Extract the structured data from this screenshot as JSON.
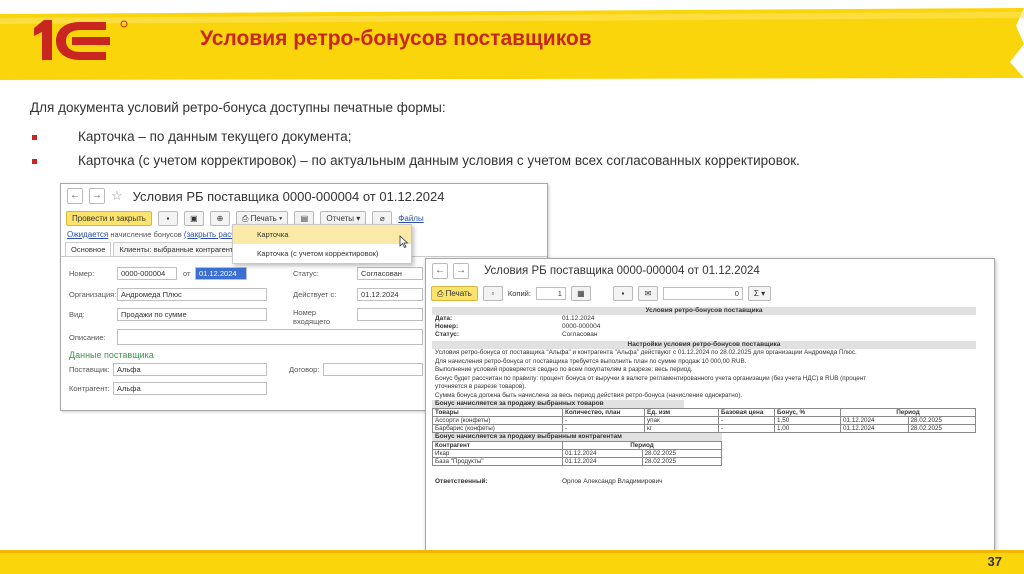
{
  "slide": {
    "title": "Условия ретро-бонусов поставщиков",
    "intro": "Для документа условий ретро-бонуса доступны печатные формы:",
    "bullets": [
      "Карточка – по данным текущего документа;",
      "Карточка (с учетом корректировок) – по актуальным данным условия с учетом всех согласованных корректировок."
    ],
    "page_number": "37",
    "colors": {
      "accent": "#c8261e",
      "brand_yellow": "#fbd50c"
    }
  },
  "win1": {
    "title": "Условия РБ поставщика 0000-000004 от 01.12.2024",
    "toolbar": {
      "post_close": "Провести и закрыть",
      "print": "Печать",
      "reports": "Отчеты",
      "files": "Файлы"
    },
    "status_link": "Ожидается",
    "status_text": "начисление бонусов",
    "status_link2": "(закрыть расчеты)",
    "tabs": [
      "Основное",
      "Клиенты: выбранные контрагенты и"
    ],
    "fields": {
      "number_label": "Номер:",
      "number_value": "0000-000004",
      "from_label": "от",
      "date_value": "01.12.2024",
      "status_label": "Статус:",
      "status_value": "Согласован",
      "org_label": "Организация:",
      "org_value": "Андромеда Плюс",
      "valid_label": "Действует с:",
      "valid_value": "01.12.2024",
      "type_label": "Вид:",
      "type_value": "Продажи по сумме",
      "incoming_label": "Номер входящего документа",
      "desc_label": "Описание:",
      "supplier_section": "Данные поставщика",
      "supplier_label": "Поставщик:",
      "supplier_value": "Альфа",
      "contract_label": "Договор:",
      "counterparty_label": "Контрагент:",
      "counterparty_value": "Альфа"
    },
    "dropdown": [
      "Карточка",
      "Карточка (с учетом корректировок)"
    ]
  },
  "win2": {
    "title": "Условия РБ поставщика 0000-000004 от 01.12.2024",
    "print_label": "Печать",
    "copies_label": "Копий:",
    "copies_value": "1",
    "sum_value": "0",
    "sigma": "Σ",
    "header_band": "Условия ретро-бонусов поставщика",
    "date_label": "Дата:",
    "date_value": "01.12.2024",
    "number_label": "Номер:",
    "number_value": "0000-000004",
    "status_label": "Статус:",
    "status_value": "Согласован",
    "settings_band": "Настройки условия ретро-бонусов поставщика",
    "paragraphs": [
      "Условия ретро-бонуса от поставщика \"Альфа\" и контрагента \"Альфа\" действуют с 01.12.2024 по 28.02.2025 для организации Андромеда Плюс.",
      "Для начисления ретро-бонуса от поставщика требуется выполнить план по сумме продаж 10 000,00 RUB.",
      "Выполнение условий проверяется сводно по всем покупателям в разрезе: весь период.",
      "Бонус будет рассчитан по правилу: процент бонуса от выручки в валюте регламентированного учета организации (без учета НДС) в RUB (процент",
      "уточняется в разрезе товаров).",
      "Сумма бонуса должна быть начислена за весь период действия ретро-бонуса (начисление однократно)."
    ],
    "goods_band": "Бонус начисляется за продажу выбранных товаров",
    "goods_headers": [
      "Товары",
      "Количество, план",
      "Ед. изм",
      "Базовая цена",
      "Бонус, %",
      "Период"
    ],
    "goods_rows": [
      [
        "Ассорти (конфеты)",
        "-",
        "упак",
        "-",
        "1,50",
        "01.12.2024",
        "28.02.2025"
      ],
      [
        "Барбарис (конфеты)",
        "-",
        "кг",
        "-",
        "1,00",
        "01.12.2024",
        "28.02.2025"
      ]
    ],
    "cp_band": "Бонус начисляется за продажу выбранным контрагентам",
    "cp_headers": [
      "Контрагент",
      "Период"
    ],
    "cp_rows": [
      [
        "Икар",
        "01.12.2024",
        "28.02.2025"
      ],
      [
        "База \"Продукты\"",
        "01.12.2024",
        "28.02.2025"
      ]
    ],
    "responsible_label": "Ответственный:",
    "responsible_value": "Орлов Александр Владимирович"
  }
}
